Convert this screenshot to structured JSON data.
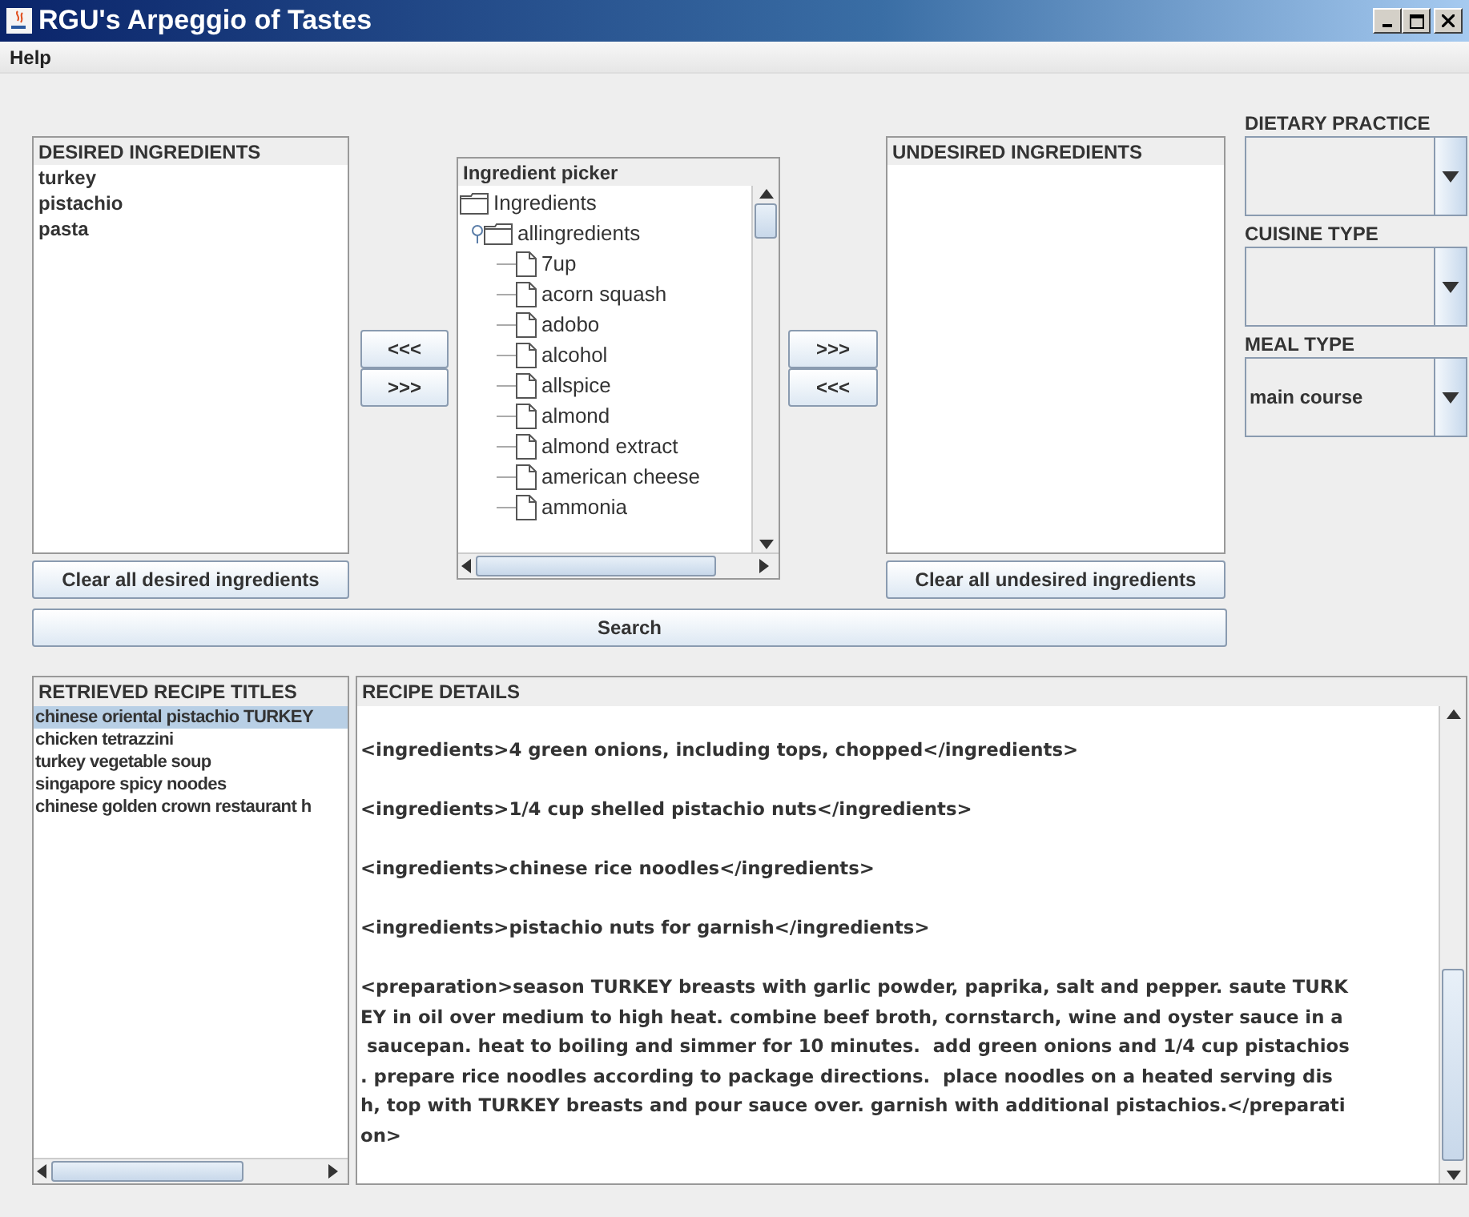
{
  "window": {
    "title": "RGU's Arpeggio of Tastes"
  },
  "menu": [
    {
      "label": "Help"
    }
  ],
  "desired": {
    "title": "DESIRED INGREDIENTS",
    "items": [
      "turkey",
      "pistachio",
      "pasta"
    ],
    "clear_button": "Clear all desired ingredients"
  },
  "desired_arrows": [
    "<<<",
    ">>>"
  ],
  "picker": {
    "title": "Ingredient picker",
    "tree": [
      {
        "label": "Ingredients",
        "kind": "folder",
        "children": [
          {
            "label": "allingredients",
            "kind": "folder",
            "expanded": true,
            "children": [
              {
                "label": "7up",
                "kind": "file"
              },
              {
                "label": "acorn squash",
                "kind": "file"
              },
              {
                "label": "adobo",
                "kind": "file"
              },
              {
                "label": "alcohol",
                "kind": "file"
              },
              {
                "label": "allspice",
                "kind": "file"
              },
              {
                "label": "almond",
                "kind": "file"
              },
              {
                "label": "almond extract",
                "kind": "file"
              },
              {
                "label": "american cheese",
                "kind": "file"
              },
              {
                "label": "ammonia",
                "kind": "file"
              }
            ]
          }
        ]
      }
    ]
  },
  "undesired_arrows": [
    ">>>",
    "<<<"
  ],
  "undesired": {
    "title": "UNDESIRED INGREDIENTS",
    "clear_button": "Clear all undesired ingredients"
  },
  "filters": [
    {
      "label": "DIETARY PRACTICE"
    },
    {
      "label": "CUISINE TYPE"
    },
    {
      "label": "MEAL TYPE",
      "value": "main course"
    }
  ],
  "search_button": "Search",
  "recipes": {
    "title": "RETRIEVED RECIPE TITLES",
    "items": [
      {
        "label": "chinese oriental pistachio TURKEY",
        "selected": true
      },
      {
        "label": "chicken tetrazzini",
        "selected": false
      },
      {
        "label": "turkey vegetable soup",
        "selected": false
      },
      {
        "label": "singapore spicy noodes",
        "selected": false
      },
      {
        "label": "chinese golden crown restaurant h",
        "selected": false
      }
    ]
  },
  "details": {
    "title": "RECIPE DETAILS",
    "paragraphs": [
      {
        "lines": [
          "<ingredients>4 green onions, including tops, chopped</ingredients>"
        ]
      },
      {
        "lines": [
          "<ingredients>1/4 cup shelled pistachio nuts</ingredients>"
        ]
      },
      {
        "lines": [
          "<ingredients>chinese rice noodles</ingredients>"
        ]
      },
      {
        "lines": [
          "<ingredients>pistachio nuts for garnish</ingredients>"
        ]
      },
      {
        "lines": [
          "<preparation>season TURKEY breasts with garlic powder, paprika, salt and pepper. saute TURK",
          "EY in oil over medium to high heat. combine beef broth, cornstarch, wine and oyster sauce in a",
          " saucepan. heat to boiling and simmer for 10 minutes.  add green onions and 1/4 cup pistachios",
          ". prepare rice noodles according to package directions.  place noodles on a heated serving dis",
          "h, top with TURKEY breasts and pour sauce over. garnish with additional pistachios.</preparati",
          "on>"
        ]
      }
    ]
  }
}
